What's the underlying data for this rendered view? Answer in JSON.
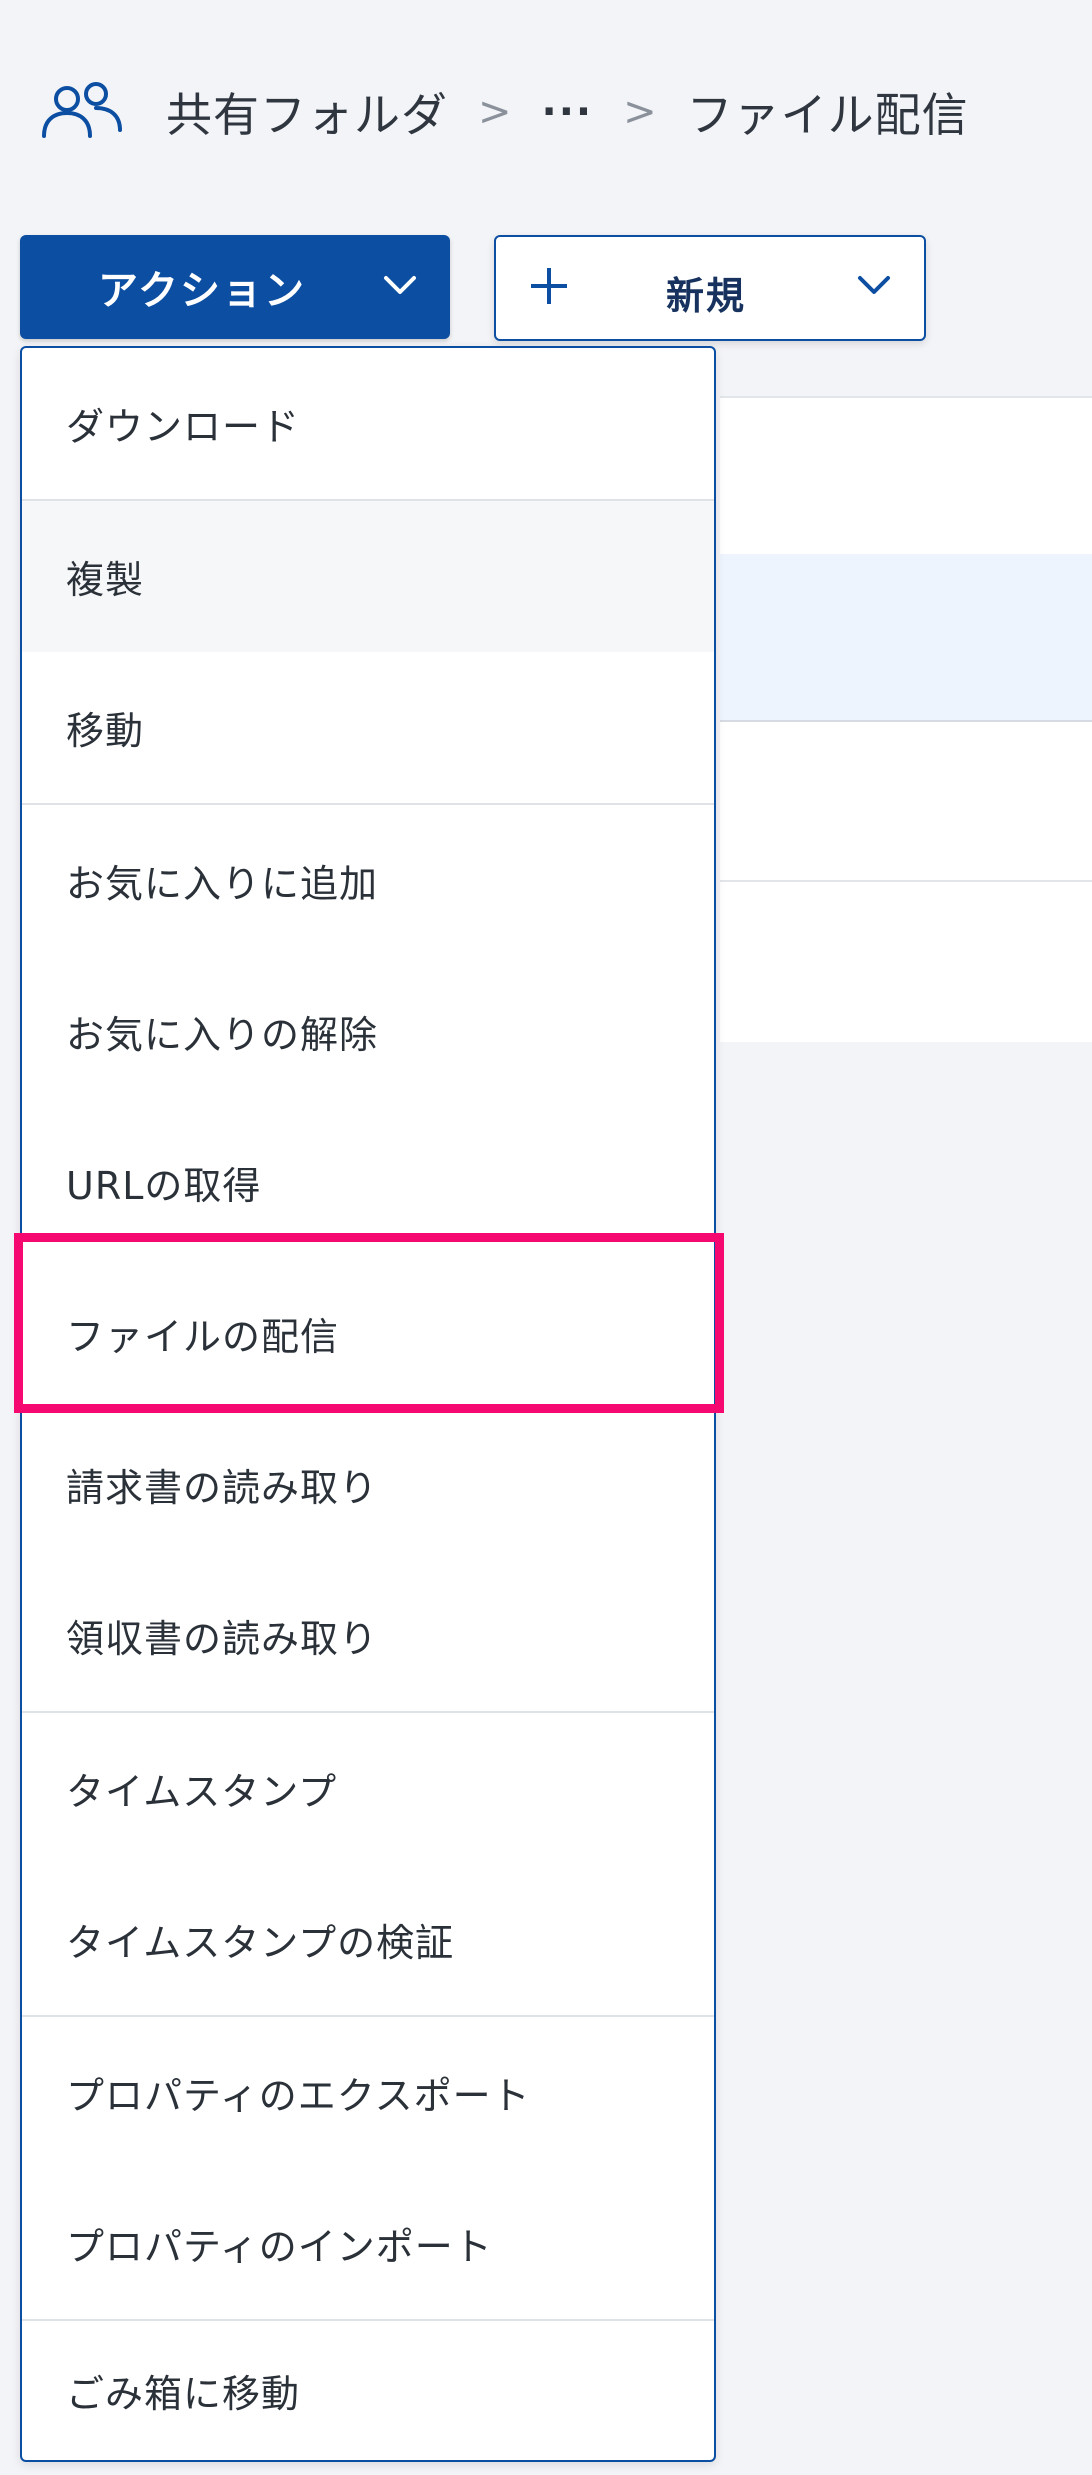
{
  "breadcrumb": {
    "icon": "shared-users-icon",
    "root": "共有フォルダ",
    "separator": ">",
    "ellipsis": "···",
    "current": "ファイル配信"
  },
  "toolbar": {
    "action_label": "アクション",
    "new_label": "新規"
  },
  "menu": {
    "items": [
      {
        "label": "ダウンロード"
      },
      {
        "label": "複製"
      },
      {
        "label": "移動"
      },
      {
        "label": "お気に入りに追加"
      },
      {
        "label": "お気に入りの解除"
      },
      {
        "label": "URLの取得"
      },
      {
        "label": "ファイルの配信"
      },
      {
        "label": "請求書の読み取り"
      },
      {
        "label": "領収書の読み取り"
      },
      {
        "label": "タイムスタンプ"
      },
      {
        "label": "タイムスタンプの検証"
      },
      {
        "label": "プロパティのエクスポート"
      },
      {
        "label": "プロパティのインポート"
      },
      {
        "label": "ごみ箱に移動"
      }
    ],
    "hovered_item": "複製",
    "highlighted_item": "ファイルの配信"
  },
  "colors": {
    "primary": "#0c4ea2",
    "highlight": "#f5086f",
    "background": "#f3f4f7"
  }
}
